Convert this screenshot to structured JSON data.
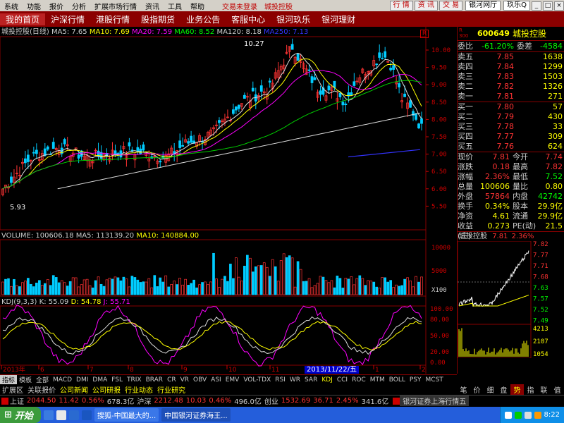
{
  "menu": {
    "items": [
      "系统",
      "功能",
      "报价",
      "分析",
      "扩展市场行情",
      "资讯",
      "工具",
      "帮助"
    ],
    "status": "交易未登录",
    "stock_name": "城投控股",
    "right_buttons": [
      "行 情",
      "资 讯",
      "交 易"
    ],
    "bank": "银河网厅",
    "window_title": "玖乐Q"
  },
  "nav": [
    "我的首页",
    "沪深行情",
    "港股行情",
    "股指期货",
    "业务公告",
    "客服中心",
    "银河玖乐",
    "银河理财"
  ],
  "chart": {
    "header": {
      "title": "城投控股(日线)",
      "ma5": "MA5: 7.65",
      "ma10": "MA10: 7.69",
      "ma20": "MA20: 7.59",
      "ma60": "MA60: 8.52",
      "ma120": "MA120: 8.18",
      "ma250": "MA250: 7.13"
    },
    "high_label": "10.27",
    "low_label": "5.93",
    "price_axis": [
      "10.00",
      "9.50",
      "9.00",
      "8.50",
      "8.00",
      "7.50",
      "7.00",
      "6.50",
      "6.00",
      "5.50"
    ],
    "volume_header": {
      "vol": "VOLUME: 100606.18",
      "ma5": "MA5: 113139.20",
      "ma10": "MA10: 140884.00"
    },
    "volume_axis": [
      "10000",
      "5000"
    ],
    "volume_unit": "X100",
    "kdj_header": {
      "title": "KDJ(9,3,3)",
      "k": "K: 55.09",
      "d": "D: 54.78",
      "j": "J: 55.71"
    },
    "kdj_axis": [
      "100.00",
      "80.00",
      "50.00",
      "20.00",
      "0.00"
    ],
    "time_axis": [
      "2013年",
      "6",
      "7",
      "8",
      "9",
      "10",
      "11",
      "1",
      "2"
    ],
    "date_cursor": "2013/11/22/五",
    "flag": "R"
  },
  "quote": {
    "tag": "R\n300",
    "code": "600649",
    "name": "城投控股",
    "weibi_k": "委比",
    "weibi_v": "-61.20%",
    "weicha_k": "委差",
    "weicha_v": "-4584",
    "sells": [
      {
        "k": "卖五",
        "p": "7.85",
        "v": "1638"
      },
      {
        "k": "卖四",
        "p": "7.84",
        "v": "1299"
      },
      {
        "k": "卖三",
        "p": "7.83",
        "v": "1503"
      },
      {
        "k": "卖二",
        "p": "7.82",
        "v": "1326"
      },
      {
        "k": "卖一",
        "p": "7.81",
        "v": "271"
      }
    ],
    "buys": [
      {
        "k": "买一",
        "p": "7.80",
        "v": "57"
      },
      {
        "k": "买二",
        "p": "7.79",
        "v": "430"
      },
      {
        "k": "买三",
        "p": "7.78",
        "v": "33"
      },
      {
        "k": "买四",
        "p": "7.77",
        "v": "309"
      },
      {
        "k": "买五",
        "p": "7.76",
        "v": "624"
      }
    ],
    "stats": [
      {
        "k1": "现价",
        "v1": "7.81",
        "k2": "今开",
        "v2": "7.74",
        "c1": "#f33",
        "c2": "#f33"
      },
      {
        "k1": "涨跌",
        "v1": "0.18",
        "k2": "最高",
        "v2": "7.82",
        "c1": "#f33",
        "c2": "#f33"
      },
      {
        "k1": "涨幅",
        "v1": "2.36%",
        "k2": "最低",
        "v2": "7.52",
        "c1": "#f33",
        "c2": "#0f0"
      },
      {
        "k1": "总量",
        "v1": "100606",
        "k2": "量比",
        "v2": "0.80",
        "c1": "#ff0",
        "c2": "#ff0"
      },
      {
        "k1": "外盘",
        "v1": "57864",
        "k2": "内盘",
        "v2": "42742",
        "c1": "#f33",
        "c2": "#0f0"
      },
      {
        "k1": "换手",
        "v1": "0.34%",
        "k2": "股本",
        "v2": "29.9亿",
        "c1": "#ff0",
        "c2": "#ff0"
      },
      {
        "k1": "净资",
        "v1": "4.61",
        "k2": "流通",
        "v2": "29.9亿",
        "c1": "#ff0",
        "c2": "#ff0"
      },
      {
        "k1": "收益(三)",
        "v1": "0.273",
        "k2": "PE(动)",
        "v2": "21.5",
        "c1": "#ff0",
        "c2": "#ff0"
      }
    ],
    "mini_title": "城投控股",
    "mini_price": "7.81",
    "mini_pct": "2.36%",
    "mini_axis": [
      "7.82",
      "7.77",
      "7.71",
      "7.68",
      "7.63",
      "7.57",
      "7.52",
      "7.49"
    ],
    "mini_vol_axis": [
      "4213",
      "2107",
      "1054"
    ]
  },
  "tabs_a": [
    "指标",
    "模板",
    "全部",
    "MACD",
    "DMI",
    "DMA",
    "FSL",
    "TRIX",
    "BRAR",
    "CR",
    "VR",
    "OBV",
    "ASI",
    "EMV",
    "VOL-TDX",
    "RSI",
    "WR",
    "SAR",
    "KDJ",
    "CCI",
    "ROC",
    "MTM",
    "BOLL",
    "PSY",
    "MCST"
  ],
  "tabs_b": [
    "扩展区",
    "关联报价",
    "公司新闻",
    "公司研报",
    "行业动态",
    "行业研究"
  ],
  "right_tabs": [
    "笔",
    "价",
    "细",
    "盘",
    "势",
    "指",
    "联",
    "值"
  ],
  "index_bar": {
    "sh_k": "上证",
    "sh_v": "2044.50",
    "sh_c": "11.42",
    "sh_p": "0.56%",
    "sh_a": "678.3亿",
    "sz_k": "沪深",
    "sz_v": "2212.48",
    "sz_c": "10.03",
    "sz_p": "0.46%",
    "sz_a": "496.0亿",
    "cy_k": "创业",
    "cy_v": "1532.69",
    "cy_c": "36.71",
    "cy_p": "2.45%",
    "cy_a": "341.6亿",
    "ticker": "银河证券上海行情五"
  },
  "taskbar": {
    "start": "开始",
    "tasks": [
      "搜狐-中国最大的...",
      "中国银河证券海王..."
    ],
    "time": "8:22"
  }
}
